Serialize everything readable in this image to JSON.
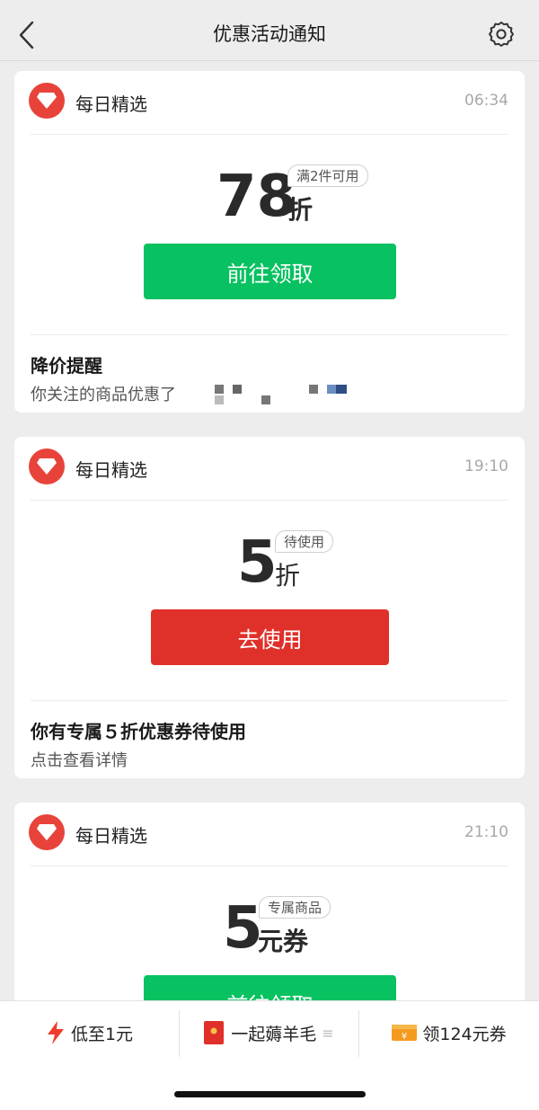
{
  "header": {
    "title": "优惠活动通知"
  },
  "cards": [
    {
      "source": "每日精选",
      "time": "06:34",
      "value": "78",
      "unit": "折",
      "tag": "满2件可用",
      "button": "前往领取",
      "button_color": "#08c160",
      "footer_title": "降价提醒",
      "footer_text": "你关注的商品优惠了"
    },
    {
      "source": "每日精选",
      "time": "19:10",
      "value": "5",
      "unit": "折",
      "tag": "待使用",
      "button": "去使用",
      "button_color": "#e0302a",
      "footer_title": "你有专属５折优惠券待使用",
      "footer_text": "点击查看详情"
    },
    {
      "source": "每日精选",
      "time": "21:10",
      "value": "5",
      "unit": "元券",
      "tag": "专属商品",
      "button": "前往领取",
      "button_color": "#08c160"
    }
  ],
  "bottom_bar": {
    "items": [
      {
        "label": "低至1元",
        "icon": "lightning-icon"
      },
      {
        "label": "一起薅羊毛",
        "icon": "red-packet-icon"
      },
      {
        "label": "领124元券",
        "icon": "coupon-icon"
      }
    ]
  },
  "colors": {
    "accent_green": "#08c160",
    "accent_red": "#e0302a",
    "brand_red": "#e8433a"
  }
}
